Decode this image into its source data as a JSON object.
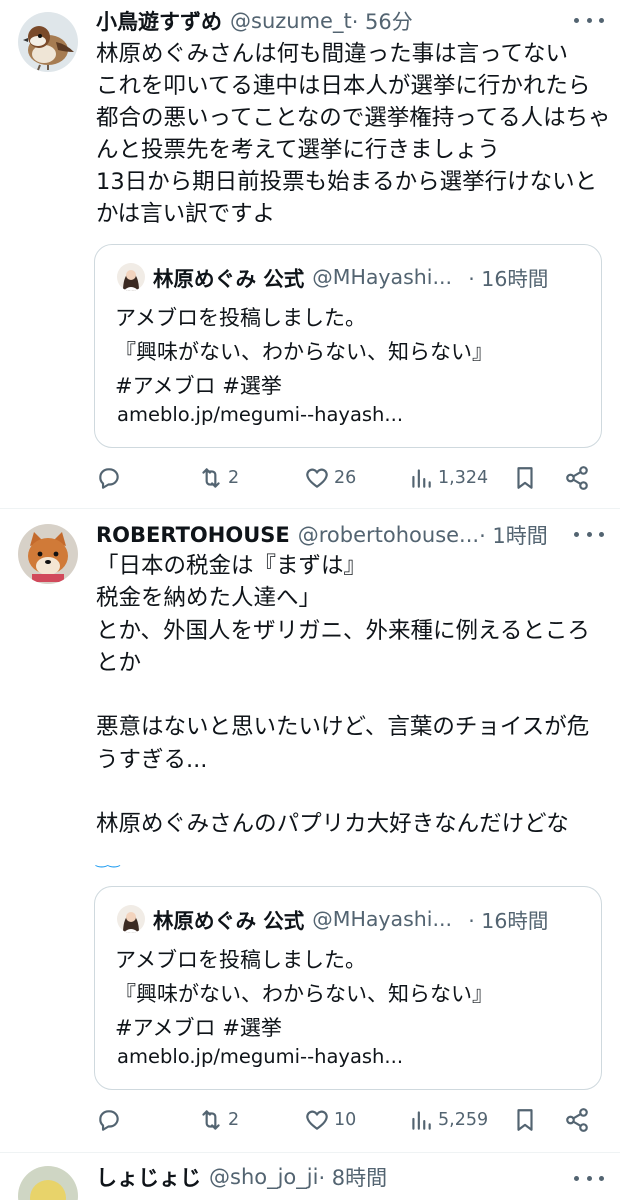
{
  "tweets": [
    {
      "name": "小鳥遊すずめ",
      "handle": "@suzume_t",
      "time": "· 56分",
      "text": "林原めぐみさんは何も間違った事は言ってない\nこれを叩いてる連中は日本人が選挙に行かれたら都合の悪いってことなので選挙権持ってる人はちゃんと投票先を考えて選挙に行きましょう\n13日から期日前投票も始まるから選挙行けないとかは言い訳ですよ",
      "emoji": "",
      "quote": {
        "name": "林原めぐみ 公式",
        "handle": "@MHayashi...",
        "time": "· 16時間",
        "text": "アメブロを投稿しました。\n『興味がない、わからない、知らない』\n#アメブロ #選挙",
        "link": "ameblo.jp/megumi--hayash..."
      },
      "stats": {
        "retweets": "2",
        "likes": "26",
        "views": "1,324"
      }
    },
    {
      "name": "ROBERTOHOUSE",
      "handle": "@robertohouse...",
      "time": "· 1時間",
      "text": "「日本の税金は『まずは』\n税金を納めた人達へ」\nとか、外国人をザリガニ、外来種に例えるところとか\n\n悪意はないと思いたいけど、言葉のチョイスが危うすぎる...\n\n林原めぐみさんのパプリカ大好きなんだけどな",
      "emoji": "‿‿",
      "quote": {
        "name": "林原めぐみ 公式",
        "handle": "@MHayashi...",
        "time": "· 16時間",
        "text": "アメブロを投稿しました。\n『興味がない、わからない、知らない』\n#アメブロ #選挙",
        "link": "ameblo.jp/megumi--hayash..."
      },
      "stats": {
        "retweets": "2",
        "likes": "10",
        "views": "5,259"
      }
    },
    {
      "name": "しょじょじ",
      "handle": "@sho_jo_ji",
      "time": "· 8時間"
    }
  ],
  "icons": {
    "reply": "reply-icon",
    "retweet": "retweet-icon",
    "like": "heart-icon",
    "views": "views-icon",
    "bookmark": "bookmark-icon",
    "share": "share-icon",
    "more": "more-icon"
  },
  "colors": {
    "text": "#0f1419",
    "muted": "#536471",
    "border": "#cfd9de",
    "accent": "#1d9bf0"
  }
}
